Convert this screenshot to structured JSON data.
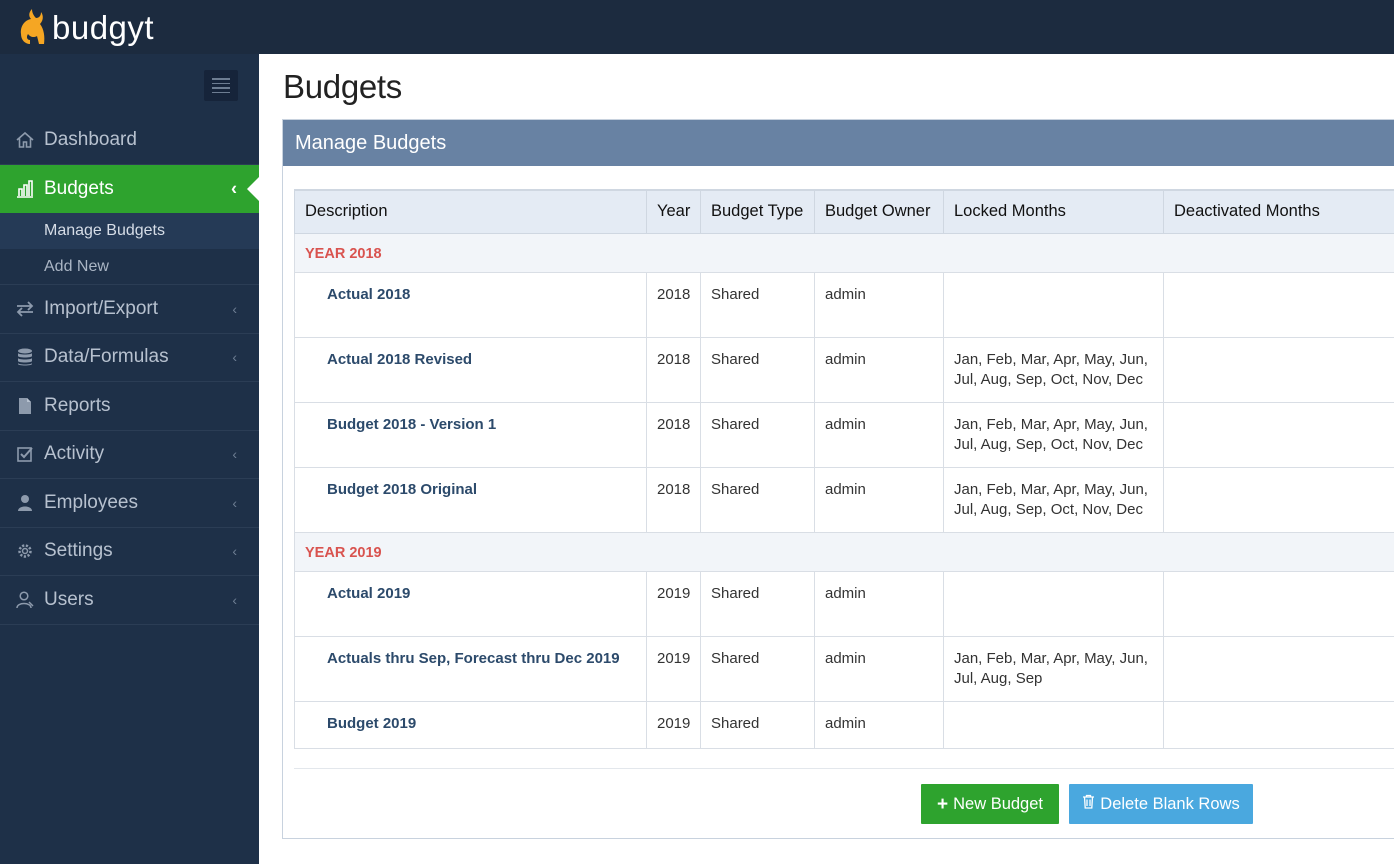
{
  "app": {
    "logo_text": "budgyt"
  },
  "sidebar": {
    "items": [
      {
        "label": "Dashboard",
        "icon": "home-icon"
      },
      {
        "label": "Budgets",
        "icon": "bar-chart-icon",
        "active": true
      },
      {
        "label": "Import/Export",
        "icon": "exchange-icon"
      },
      {
        "label": "Data/Formulas",
        "icon": "database-icon"
      },
      {
        "label": "Reports",
        "icon": "file-icon"
      },
      {
        "label": "Activity",
        "icon": "check-square-icon"
      },
      {
        "label": "Employees",
        "icon": "user-icon"
      },
      {
        "label": "Settings",
        "icon": "gear-icon"
      },
      {
        "label": "Users",
        "icon": "users-icon"
      }
    ],
    "sub_items": [
      {
        "label": "Manage Budgets",
        "current": true
      },
      {
        "label": "Add New"
      }
    ]
  },
  "main": {
    "title": "Budgets",
    "panel_title": "Manage Budgets",
    "columns": [
      "Description",
      "Year",
      "Budget Type",
      "Budget Owner",
      "Locked Months",
      "Deactivated Months"
    ],
    "groups": [
      {
        "label": "YEAR 2018",
        "rows": [
          {
            "description": "Actual 2018",
            "year": "2018",
            "type": "Shared",
            "owner": "admin",
            "locked": "",
            "deactivated": ""
          },
          {
            "description": "Actual 2018 Revised",
            "year": "2018",
            "type": "Shared",
            "owner": "admin",
            "locked": "Jan, Feb, Mar, Apr, May, Jun, Jul, Aug, Sep, Oct, Nov, Dec",
            "deactivated": ""
          },
          {
            "description": "Budget 2018 - Version 1",
            "year": "2018",
            "type": "Shared",
            "owner": "admin",
            "locked": "Jan, Feb, Mar, Apr, May, Jun, Jul, Aug, Sep, Oct, Nov, Dec",
            "deactivated": ""
          },
          {
            "description": "Budget 2018 Original",
            "year": "2018",
            "type": "Shared",
            "owner": "admin",
            "locked": "Jan, Feb, Mar, Apr, May, Jun, Jul, Aug, Sep, Oct, Nov, Dec",
            "deactivated": ""
          }
        ]
      },
      {
        "label": "YEAR 2019",
        "rows": [
          {
            "description": "Actual 2019",
            "year": "2019",
            "type": "Shared",
            "owner": "admin",
            "locked": "",
            "deactivated": ""
          },
          {
            "description": "Actuals thru Sep, Forecast thru Dec 2019",
            "year": "2019",
            "type": "Shared",
            "owner": "admin",
            "locked": "Jan, Feb, Mar, Apr, May, Jun, Jul, Aug, Sep",
            "deactivated": ""
          },
          {
            "description": "Budget 2019",
            "year": "2019",
            "type": "Shared",
            "owner": "admin",
            "locked": "",
            "deactivated": ""
          }
        ]
      }
    ],
    "buttons": {
      "new_budget": "New Budget",
      "delete_blank_rows": "Delete Blank Rows"
    }
  },
  "colors": {
    "topbar": "#1c2b3f",
    "sidebar": "#1e3048",
    "active": "#2ea32e",
    "panel_head": "#6882a3",
    "group_label": "#d9534f",
    "delete_btn": "#4aa8df"
  }
}
